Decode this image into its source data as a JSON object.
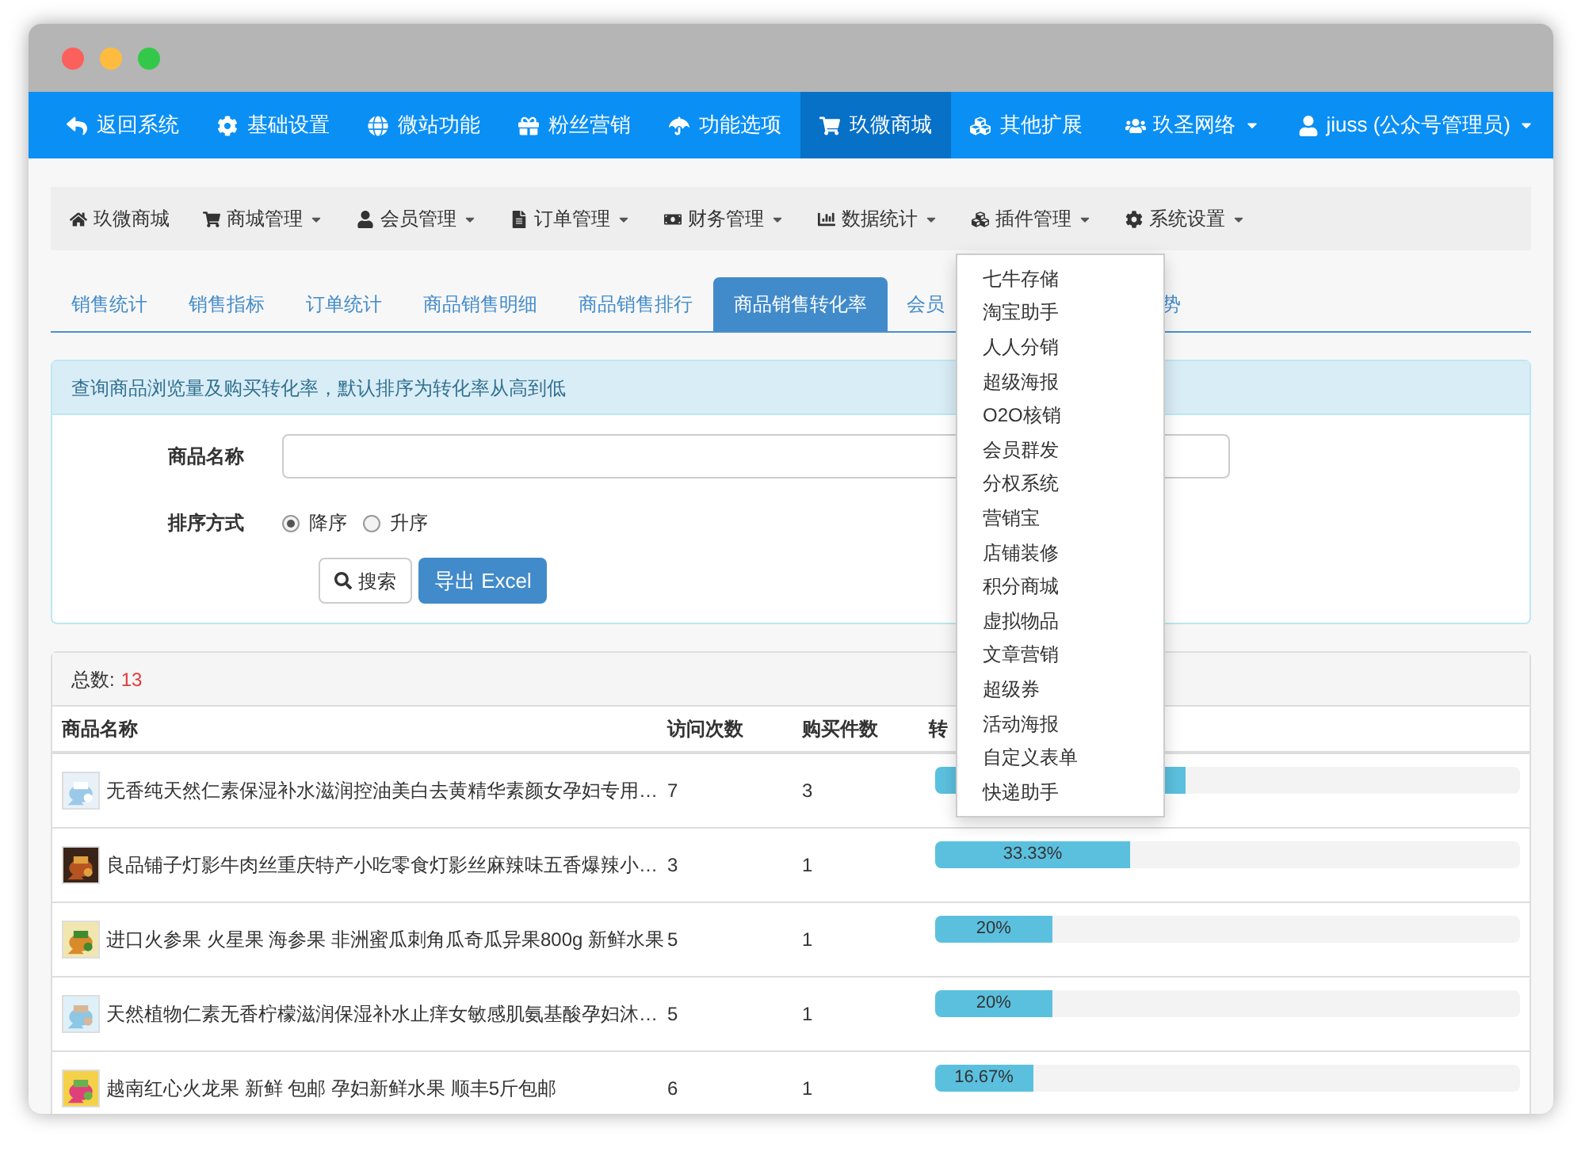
{
  "top_nav": {
    "items": [
      {
        "label": "返回系统",
        "selected": false
      },
      {
        "label": "基础设置",
        "selected": false
      },
      {
        "label": "微站功能",
        "selected": false
      },
      {
        "label": "粉丝营销",
        "selected": false
      },
      {
        "label": "功能选项",
        "selected": false
      },
      {
        "label": "玖微商城",
        "selected": true
      },
      {
        "label": "其他扩展",
        "selected": false
      }
    ],
    "right": [
      {
        "label": "玖圣网络"
      },
      {
        "label": "jiuss (公众号管理员)"
      }
    ]
  },
  "sub_nav": [
    {
      "label": "玖微商城",
      "dropdown": false
    },
    {
      "label": "商城管理",
      "dropdown": true
    },
    {
      "label": "会员管理",
      "dropdown": true
    },
    {
      "label": "订单管理",
      "dropdown": true
    },
    {
      "label": "财务管理",
      "dropdown": true
    },
    {
      "label": "数据统计",
      "dropdown": true
    },
    {
      "label": "插件管理",
      "dropdown": true
    },
    {
      "label": "系统设置",
      "dropdown": true
    }
  ],
  "plugin_menu": [
    "七牛存储",
    "淘宝助手",
    "人人分销",
    "超级海报",
    "O2O核销",
    "会员群发",
    "分权系统",
    "营销宝",
    "店铺装修",
    "积分商城",
    "虚拟物品",
    "文章营销",
    "超级券",
    "活动海报",
    "自定义表单",
    "快递助手"
  ],
  "tabs": [
    {
      "label": "销售统计",
      "selected": false
    },
    {
      "label": "销售指标",
      "selected": false
    },
    {
      "label": "订单统计",
      "selected": false
    },
    {
      "label": "商品销售明细",
      "selected": false
    },
    {
      "label": "商品销售排行",
      "selected": false
    },
    {
      "label": "商品销售转化率",
      "selected": true
    },
    {
      "label": "会员",
      "selected": false
    },
    {
      "label": "势",
      "selected": false
    }
  ],
  "query": {
    "info": "查询商品浏览量及购买转化率，默认排序为转化率从高到低",
    "name_label": "商品名称",
    "sort_label": "排序方式",
    "sort_options": [
      {
        "label": "降序",
        "selected": true
      },
      {
        "label": "升序",
        "selected": false
      }
    ],
    "search_button": "搜索",
    "export_button": "导出 Excel"
  },
  "results": {
    "total_label": "总数:",
    "total": "13",
    "columns": [
      "商品名称",
      "访问次数",
      "购买件数",
      "转"
    ],
    "rows": [
      {
        "name": "无香纯天然仁素保湿补水滋润控油美白去黄精华素颜女孕妇专用…",
        "visits": "7",
        "purchases": "3",
        "level": 0.4286
      },
      {
        "name": "良品铺子灯影牛肉丝重庆特产小吃零食灯影丝麻辣味五香爆辣小…",
        "visits": "3",
        "purchases": "1",
        "level": 0.3333,
        "reading": "33.33%"
      },
      {
        "name": "进口火参果 火星果 海参果 非洲蜜瓜刺角瓜奇瓜异果800g 新鲜水果",
        "visits": "5",
        "purchases": "1",
        "level": 0.2,
        "reading": "20%"
      },
      {
        "name": "天然植物仁素无香柠檬滋润保湿补水止痒女敏感肌氨基酸孕妇沐…",
        "visits": "5",
        "purchases": "1",
        "level": 0.2,
        "reading": "20%"
      },
      {
        "name": "越南红心火龙果 新鲜 包邮 孕妇新鲜水果 顺丰5斤包邮",
        "visits": "6",
        "purchases": "1",
        "level": 0.1667,
        "reading": "16.67%"
      }
    ]
  }
}
